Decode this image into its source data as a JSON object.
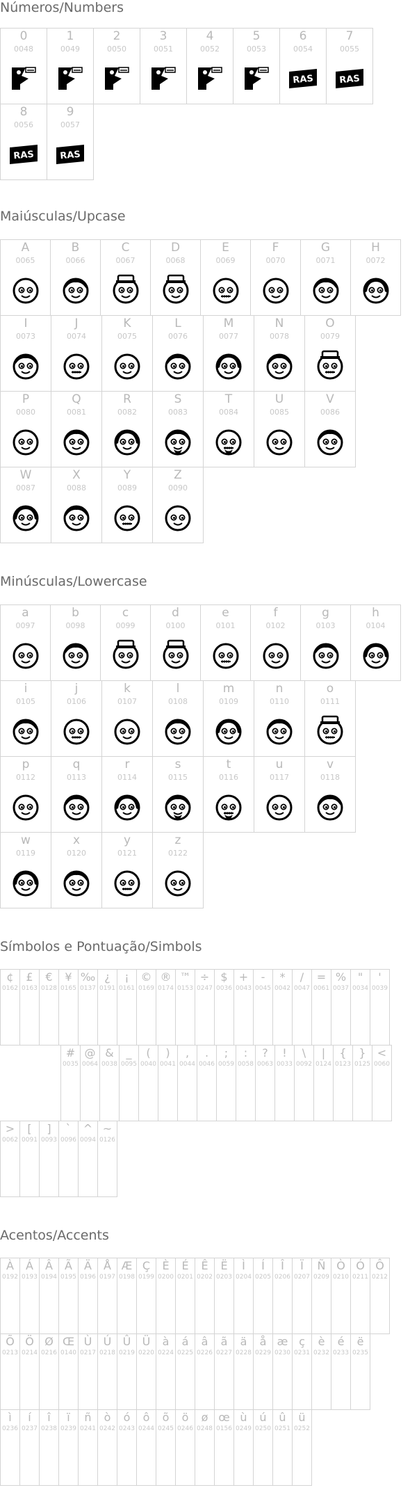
{
  "sections": [
    {
      "id": "numbers",
      "title": "Números/Numbers",
      "kind": "big",
      "cells": [
        {
          "ch": "0",
          "code": "0048",
          "glyph": "bird"
        },
        {
          "ch": "1",
          "code": "0049",
          "glyph": "bird"
        },
        {
          "ch": "2",
          "code": "0050",
          "glyph": "bird"
        },
        {
          "ch": "3",
          "code": "0051",
          "glyph": "bird"
        },
        {
          "ch": "4",
          "code": "0052",
          "glyph": "bird"
        },
        {
          "ch": "5",
          "code": "0053",
          "glyph": "bird"
        },
        {
          "ch": "6",
          "code": "0054",
          "glyph": "ras"
        },
        {
          "ch": "7",
          "code": "0055",
          "glyph": "ras"
        },
        {
          "ch": "8",
          "code": "0056",
          "glyph": "ras"
        },
        {
          "ch": "9",
          "code": "0057",
          "glyph": "ras"
        }
      ]
    },
    {
      "id": "upper",
      "title": "Maiúsculas/Upcase",
      "kind": "big",
      "cells": [
        {
          "ch": "A",
          "code": "0065",
          "glyph": "face"
        },
        {
          "ch": "B",
          "code": "0066",
          "glyph": "face"
        },
        {
          "ch": "C",
          "code": "0067",
          "glyph": "face-hat"
        },
        {
          "ch": "D",
          "code": "0068",
          "glyph": "face-hat"
        },
        {
          "ch": "E",
          "code": "0069",
          "glyph": "face"
        },
        {
          "ch": "F",
          "code": "0070",
          "glyph": "face"
        },
        {
          "ch": "G",
          "code": "0071",
          "glyph": "face"
        },
        {
          "ch": "H",
          "code": "0072",
          "glyph": "face"
        },
        {
          "ch": "I",
          "code": "0073",
          "glyph": "face"
        },
        {
          "ch": "J",
          "code": "0074",
          "glyph": "face"
        },
        {
          "ch": "K",
          "code": "0075",
          "glyph": "face"
        },
        {
          "ch": "L",
          "code": "0076",
          "glyph": "face"
        },
        {
          "ch": "M",
          "code": "0077",
          "glyph": "face"
        },
        {
          "ch": "N",
          "code": "0078",
          "glyph": "face"
        },
        {
          "ch": "O",
          "code": "0079",
          "glyph": "face-hat"
        },
        {
          "ch": "P",
          "code": "0080",
          "glyph": "face"
        },
        {
          "ch": "Q",
          "code": "0081",
          "glyph": "face"
        },
        {
          "ch": "R",
          "code": "0082",
          "glyph": "face"
        },
        {
          "ch": "S",
          "code": "0083",
          "glyph": "face-beard"
        },
        {
          "ch": "T",
          "code": "0084",
          "glyph": "face-beard"
        },
        {
          "ch": "U",
          "code": "0085",
          "glyph": "face"
        },
        {
          "ch": "V",
          "code": "0086",
          "glyph": "face"
        },
        {
          "ch": "W",
          "code": "0087",
          "glyph": "face"
        },
        {
          "ch": "X",
          "code": "0088",
          "glyph": "face"
        },
        {
          "ch": "Y",
          "code": "0089",
          "glyph": "face"
        },
        {
          "ch": "Z",
          "code": "0090",
          "glyph": "face"
        }
      ]
    },
    {
      "id": "lower",
      "title": "Minúsculas/Lowercase",
      "kind": "big",
      "cells": [
        {
          "ch": "a",
          "code": "0097",
          "glyph": "face"
        },
        {
          "ch": "b",
          "code": "0098",
          "glyph": "face"
        },
        {
          "ch": "c",
          "code": "0099",
          "glyph": "face-hat"
        },
        {
          "ch": "d",
          "code": "0100",
          "glyph": "face-hat"
        },
        {
          "ch": "e",
          "code": "0101",
          "glyph": "face"
        },
        {
          "ch": "f",
          "code": "0102",
          "glyph": "face"
        },
        {
          "ch": "g",
          "code": "0103",
          "glyph": "face"
        },
        {
          "ch": "h",
          "code": "0104",
          "glyph": "face"
        },
        {
          "ch": "i",
          "code": "0105",
          "glyph": "face"
        },
        {
          "ch": "j",
          "code": "0106",
          "glyph": "face"
        },
        {
          "ch": "k",
          "code": "0107",
          "glyph": "face"
        },
        {
          "ch": "l",
          "code": "0108",
          "glyph": "face"
        },
        {
          "ch": "m",
          "code": "0109",
          "glyph": "face"
        },
        {
          "ch": "n",
          "code": "0110",
          "glyph": "face"
        },
        {
          "ch": "o",
          "code": "0111",
          "glyph": "face-hat"
        },
        {
          "ch": "p",
          "code": "0112",
          "glyph": "face"
        },
        {
          "ch": "q",
          "code": "0113",
          "glyph": "face"
        },
        {
          "ch": "r",
          "code": "0114",
          "glyph": "face"
        },
        {
          "ch": "s",
          "code": "0115",
          "glyph": "face-beard"
        },
        {
          "ch": "t",
          "code": "0116",
          "glyph": "face-beard"
        },
        {
          "ch": "u",
          "code": "0117",
          "glyph": "face"
        },
        {
          "ch": "v",
          "code": "0118",
          "glyph": "face"
        },
        {
          "ch": "w",
          "code": "0119",
          "glyph": "face"
        },
        {
          "ch": "x",
          "code": "0120",
          "glyph": "face"
        },
        {
          "ch": "y",
          "code": "0121",
          "glyph": "face"
        },
        {
          "ch": "z",
          "code": "0122",
          "glyph": "face"
        }
      ]
    },
    {
      "id": "symbols",
      "title": "Símbolos e Pontuação/Simbols",
      "kind": "small",
      "cells": [
        {
          "ch": "¢",
          "code": "0162"
        },
        {
          "ch": "£",
          "code": "0163"
        },
        {
          "ch": "€",
          "code": "0128"
        },
        {
          "ch": "¥",
          "code": "0165"
        },
        {
          "ch": "‰",
          "code": "0137"
        },
        {
          "ch": "¿",
          "code": "0191"
        },
        {
          "ch": "¡",
          "code": "0161"
        },
        {
          "ch": "©",
          "code": "0169"
        },
        {
          "ch": "®",
          "code": "0174"
        },
        {
          "ch": "™",
          "code": "0153"
        },
        {
          "ch": "÷",
          "code": "0247"
        },
        {
          "ch": "$",
          "code": "0036"
        },
        {
          "ch": "+",
          "code": "0043"
        },
        {
          "ch": "-",
          "code": "0045"
        },
        {
          "ch": "*",
          "code": "0042"
        },
        {
          "ch": "/",
          "code": "0047"
        },
        {
          "ch": "=",
          "code": "0061"
        },
        {
          "ch": "%",
          "code": "0037"
        },
        {
          "ch": "\"",
          "code": "0034"
        },
        {
          "ch": "'",
          "code": "0039"
        },
        {
          "ch": "#",
          "code": "0035"
        },
        {
          "ch": "@",
          "code": "0064"
        },
        {
          "ch": "&",
          "code": "0038"
        },
        {
          "ch": "_",
          "code": "0095"
        },
        {
          "ch": "(",
          "code": "0040"
        },
        {
          "ch": ")",
          "code": "0041"
        },
        {
          "ch": ",",
          "code": "0044"
        },
        {
          "ch": ".",
          "code": "0046"
        },
        {
          "ch": ";",
          "code": "0059"
        },
        {
          "ch": ":",
          "code": "0058"
        },
        {
          "ch": "?",
          "code": "0063"
        },
        {
          "ch": "!",
          "code": "0033"
        },
        {
          "ch": "\\",
          "code": "0092"
        },
        {
          "ch": "|",
          "code": "0124"
        },
        {
          "ch": "{",
          "code": "0123"
        },
        {
          "ch": "}",
          "code": "0125"
        },
        {
          "ch": "<",
          "code": "0060"
        },
        {
          "ch": ">",
          "code": "0062"
        },
        {
          "ch": "[",
          "code": "0091"
        },
        {
          "ch": "]",
          "code": "0093"
        },
        {
          "ch": "`",
          "code": "0096"
        },
        {
          "ch": "^",
          "code": "0094"
        },
        {
          "ch": "~",
          "code": "0126"
        }
      ]
    },
    {
      "id": "accents",
      "title": "Acentos/Accents",
      "kind": "small",
      "cells": [
        {
          "ch": "À",
          "code": "0192"
        },
        {
          "ch": "Á",
          "code": "0193"
        },
        {
          "ch": "Â",
          "code": "0194"
        },
        {
          "ch": "Ã",
          "code": "0195"
        },
        {
          "ch": "Ä",
          "code": "0196"
        },
        {
          "ch": "Å",
          "code": "0197"
        },
        {
          "ch": "Æ",
          "code": "0198"
        },
        {
          "ch": "Ç",
          "code": "0199"
        },
        {
          "ch": "È",
          "code": "0200"
        },
        {
          "ch": "É",
          "code": "0201"
        },
        {
          "ch": "Ê",
          "code": "0202"
        },
        {
          "ch": "Ë",
          "code": "0203"
        },
        {
          "ch": "Ì",
          "code": "0204"
        },
        {
          "ch": "Í",
          "code": "0205"
        },
        {
          "ch": "Î",
          "code": "0206"
        },
        {
          "ch": "Ï",
          "code": "0207"
        },
        {
          "ch": "Ñ",
          "code": "0209"
        },
        {
          "ch": "Ò",
          "code": "0210"
        },
        {
          "ch": "Ó",
          "code": "0211"
        },
        {
          "ch": "Ô",
          "code": "0212"
        },
        {
          "ch": "Õ",
          "code": "0213"
        },
        {
          "ch": "Ö",
          "code": "0214"
        },
        {
          "ch": "Ø",
          "code": "0216"
        },
        {
          "ch": "Œ",
          "code": "0140"
        },
        {
          "ch": "Ù",
          "code": "0217"
        },
        {
          "ch": "Ú",
          "code": "0218"
        },
        {
          "ch": "Û",
          "code": "0219"
        },
        {
          "ch": "Ü",
          "code": "0220"
        },
        {
          "ch": "à",
          "code": "0224"
        },
        {
          "ch": "á",
          "code": "0225"
        },
        {
          "ch": "â",
          "code": "0226"
        },
        {
          "ch": "ã",
          "code": "0227"
        },
        {
          "ch": "ä",
          "code": "0228"
        },
        {
          "ch": "å",
          "code": "0229"
        },
        {
          "ch": "æ",
          "code": "0230"
        },
        {
          "ch": "ç",
          "code": "0231"
        },
        {
          "ch": "è",
          "code": "0232"
        },
        {
          "ch": "é",
          "code": "0233"
        },
        {
          "ch": "ë",
          "code": "0235"
        },
        {
          "ch": "ì",
          "code": "0236"
        },
        {
          "ch": "í",
          "code": "0237"
        },
        {
          "ch": "î",
          "code": "0238"
        },
        {
          "ch": "ï",
          "code": "0239"
        },
        {
          "ch": "ñ",
          "code": "0241"
        },
        {
          "ch": "ò",
          "code": "0242"
        },
        {
          "ch": "ó",
          "code": "0243"
        },
        {
          "ch": "ô",
          "code": "0244"
        },
        {
          "ch": "õ",
          "code": "0245"
        },
        {
          "ch": "ö",
          "code": "0246"
        },
        {
          "ch": "ø",
          "code": "0248"
        },
        {
          "ch": "œ",
          "code": "0156"
        },
        {
          "ch": "ù",
          "code": "0249"
        },
        {
          "ch": "ú",
          "code": "0250"
        },
        {
          "ch": "û",
          "code": "0251"
        },
        {
          "ch": "ü",
          "code": "0252"
        }
      ]
    }
  ]
}
